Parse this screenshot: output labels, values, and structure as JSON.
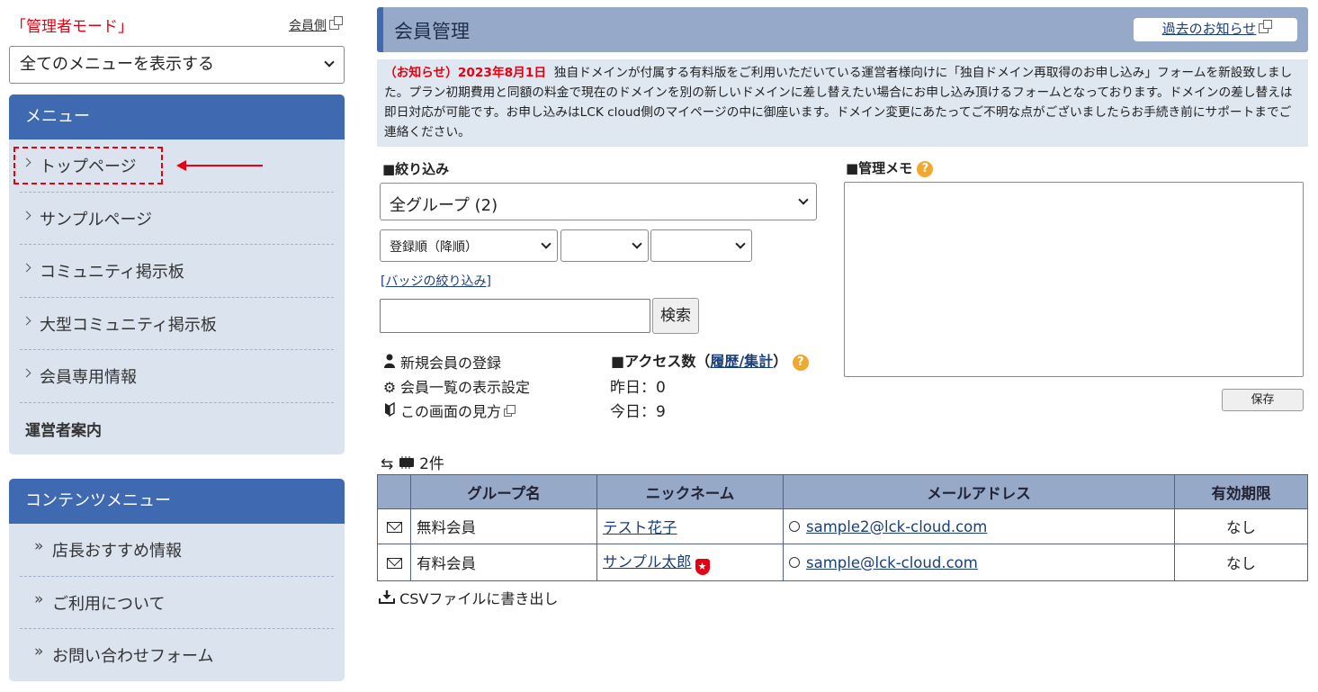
{
  "sidebar": {
    "admin_mode": "「管理者モード」",
    "member_side_link": "会員側",
    "menu_select_value": "全てのメニューを表示する",
    "menu": {
      "header": "メニュー",
      "items": [
        {
          "label": "トップページ"
        },
        {
          "label": "サンプルページ"
        },
        {
          "label": "コミュニティ掲示板"
        },
        {
          "label": "大型コミュニティ掲示板"
        },
        {
          "label": "会員専用情報"
        }
      ],
      "operator_guide": "運営者案内"
    },
    "contents_menu": {
      "header": "コンテンツメニュー",
      "items": [
        {
          "label": "店長おすすめ情報"
        },
        {
          "label": "ご利用について"
        },
        {
          "label": "お問い合わせフォーム"
        }
      ]
    }
  },
  "header": {
    "title": "会員管理",
    "past_notices_button": "過去のお知らせ"
  },
  "notice": {
    "date_label": "（お知らせ）2023年8月1日",
    "text": "独自ドメインが付属する有料版をご利用いただいている運営者様向けに「独自ドメイン再取得のお申し込み」フォームを新設致しました。プラン初期費用と同額の料金で現在のドメインを別の新しいドメインに差し替えたい場合にお申し込み頂けるフォームとなっております。ドメインの差し替えは即日対応が可能です。お申し込みはLCK cloud側のマイページの中に御座います。ドメイン変更にあたってご不明な点がございましたらお手続き前にサポートまでご連絡ください。"
  },
  "filter": {
    "label": "■絞り込み",
    "group_select": "全グループ (2)",
    "sort_select": "登録順（降順）",
    "select2": "",
    "select3": "",
    "badge_filter_link": "バッジの絞り込み",
    "search_value": "",
    "search_button": "検索"
  },
  "actions": {
    "register": "新規会員の登録",
    "list_settings": "会員一覧の表示設定",
    "howto": "この画面の見方"
  },
  "access": {
    "title_prefix": "■アクセス数（",
    "link": "履歴/集計",
    "title_suffix": "）",
    "yesterday": "昨日：0",
    "today": "今日：9",
    "help": "?"
  },
  "memo": {
    "label": "■管理メモ",
    "help": "?",
    "value": "",
    "save_button": "保存"
  },
  "list": {
    "count": "2件",
    "columns": [
      "グループ名",
      "ニックネーム",
      "メールアドレス",
      "有効期限"
    ],
    "rows": [
      {
        "group": "無料会員",
        "nickname": "テスト花子",
        "email": "sample2@lck-cloud.com",
        "expiry": "なし",
        "badge": false
      },
      {
        "group": "有料会員",
        "nickname": "サンプル太郎",
        "email": "sample@lck-cloud.com",
        "expiry": "なし",
        "badge": true
      }
    ],
    "csv_export": "CSVファイルに書き出し"
  },
  "colors": {
    "menu_header": "#3f6ab2",
    "sidebar_bg": "#dbe3ee",
    "title_bar": "#96a9c9",
    "alert_red": "#e60012",
    "help_orange": "#f0a92e"
  }
}
